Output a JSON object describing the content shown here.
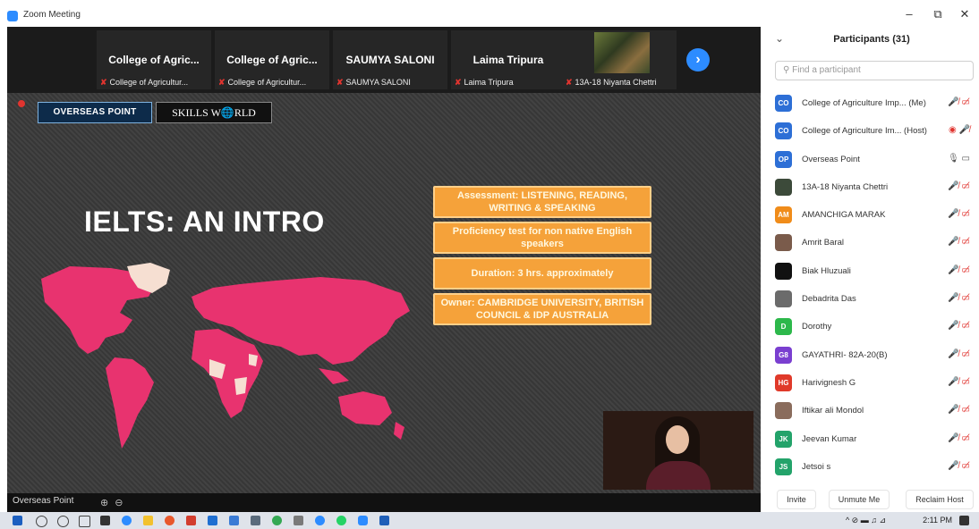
{
  "window": {
    "title": "Zoom Meeting",
    "minimize": "–",
    "restore": "⧉",
    "close": "✕"
  },
  "thumbnails": [
    {
      "name": "College of Agric...",
      "sub": "College of Agricultur..."
    },
    {
      "name": "College of Agric...",
      "sub": "College of Agricultur..."
    },
    {
      "name": "SAUMYA SALONI",
      "sub": "SAUMYA SALONI"
    },
    {
      "name": "Laima Tripura",
      "sub": "Laima Tripura"
    },
    {
      "name": "",
      "sub": "13A-18 Niyanta Chettri"
    }
  ],
  "next_icon": "›",
  "slide": {
    "logo1": "OVERSEAS POINT",
    "logo2": "SKILLS W🌐RLD",
    "title": "IELTS: AN INTRO",
    "boxes": [
      "Assessment: LISTENING, READING, WRITING & SPEAKING",
      "Proficiency test for non native English speakers",
      "Duration: 3 hrs. approximately",
      "Owner: CAMBRIDGE UNIVERSITY, BRITISH COUNCIL & IDP AUSTRALIA"
    ]
  },
  "bottombar": {
    "label": "Overseas Point",
    "dots": "⊕ ⊖"
  },
  "panel": {
    "title": "Participants (31)",
    "search_placeholder": "Find a participant",
    "participants": [
      {
        "initials": "CO",
        "color": "#2d6fd6",
        "name": "College of Agriculture Imp... (Me)",
        "icons": "🎤̸ ▭̸"
      },
      {
        "initials": "CO",
        "color": "#2d6fd6",
        "name": "College of Agriculture Im... (Host)",
        "icons": "◉ 🎤̸"
      },
      {
        "initials": "OP",
        "color": "#2d6fd6",
        "name": "Overseas Point",
        "icons": "🎙 ▭"
      },
      {
        "initials": "",
        "color": "#3c4a3a",
        "name": "13A-18 Niyanta Chettri",
        "icons": "🎤̸ ▭̸"
      },
      {
        "initials": "AM",
        "color": "#f08c1a",
        "name": "AMANCHIGA MARAK",
        "icons": "🎤̸ ▭̸"
      },
      {
        "initials": "",
        "color": "#7a5b4b",
        "name": "Amrit Baral",
        "icons": "🎤̸ ▭̸"
      },
      {
        "initials": "",
        "color": "#111111",
        "name": "Biak Hluzuali",
        "icons": "🎤̸ ▭̸"
      },
      {
        "initials": "",
        "color": "#6b6b6b",
        "name": "Debadrita Das",
        "icons": "🎤̸ ▭̸"
      },
      {
        "initials": "D",
        "color": "#2db84b",
        "name": "Dorothy",
        "icons": "🎤̸ ▭̸"
      },
      {
        "initials": "G8",
        "color": "#7a3fd0",
        "name": "GAYATHRI- 82A-20(B)",
        "icons": "🎤̸ ▭̸"
      },
      {
        "initials": "HG",
        "color": "#e03a2a",
        "name": "Harivignesh G",
        "icons": "🎤̸ ▭̸"
      },
      {
        "initials": "",
        "color": "#8a6c5c",
        "name": "Iftikar ali Mondol",
        "icons": "🎤̸ ▭̸"
      },
      {
        "initials": "JK",
        "color": "#23a36a",
        "name": "Jeevan Kumar",
        "icons": "🎤̸ ▭̸"
      },
      {
        "initials": "JS",
        "color": "#23a36a",
        "name": "Jetsoi s",
        "icons": "🎤̸ ▭̸"
      }
    ],
    "buttons": {
      "invite": "Invite",
      "unmute_me": "Unmute Me",
      "reclaim_host": "Reclaim Host"
    }
  },
  "taskbar": {
    "tray": "^ ⊘ ▬ ♫ ⊿",
    "clock": "2:11 PM"
  }
}
